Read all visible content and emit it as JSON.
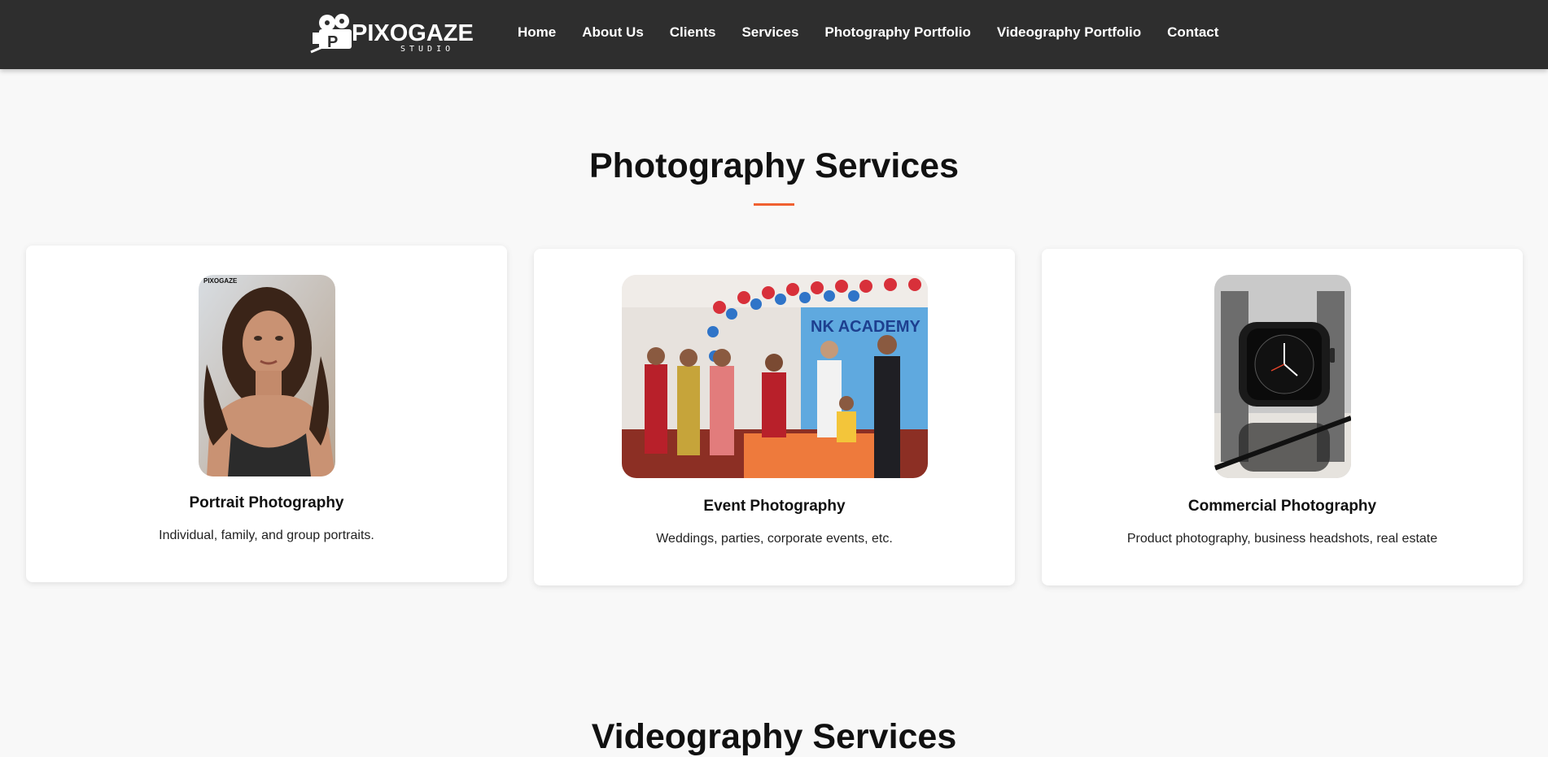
{
  "brand": {
    "name": "PIXOGAZE",
    "tagline": "STUDIO",
    "photo_watermark": "PIXOGAZE"
  },
  "nav": {
    "links": [
      "Home",
      "About Us",
      "Clients",
      "Services",
      "Photography Portfolio",
      "Videography Portfolio",
      "Contact"
    ]
  },
  "photography": {
    "title": "Photography Services",
    "cards": [
      {
        "title": "Portrait Photography",
        "description": "Individual, family, and group portraits.",
        "image": "portrait-photo"
      },
      {
        "title": "Event Photography",
        "description": "Weddings, parties, corporate events, etc.",
        "image": "event-photo"
      },
      {
        "title": "Commercial Photography",
        "description": "Product photography, business headshots, real estate",
        "image": "watch-product-photo"
      }
    ]
  },
  "videography": {
    "title": "Videography Services"
  },
  "colors": {
    "navbar": "#2e2e2e",
    "accent": "#f06030",
    "background": "#f8f8f8"
  }
}
